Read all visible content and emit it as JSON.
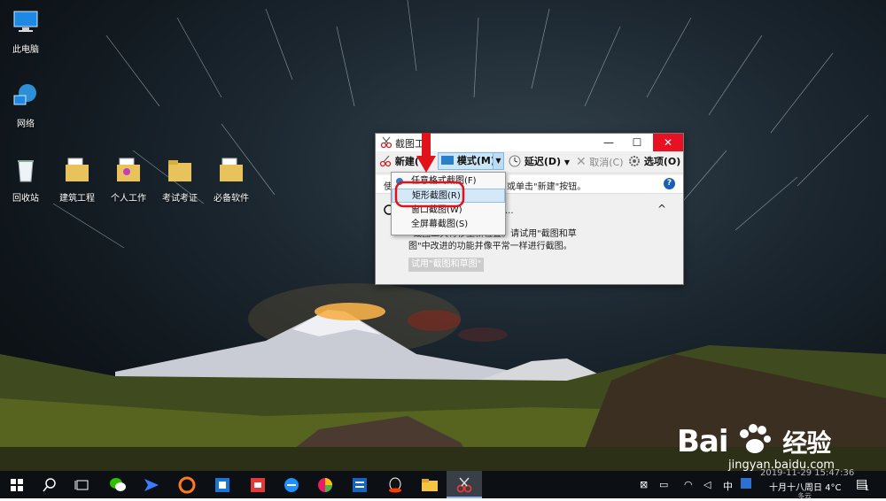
{
  "desktop_icons": [
    {
      "label": "此电脑",
      "icon": "computer-icon"
    },
    {
      "label": "网络",
      "icon": "network-icon"
    },
    {
      "label": "回收站",
      "icon": "recycle-bin-icon"
    },
    {
      "label": "建筑工程",
      "icon": "folder-icon"
    },
    {
      "label": "个人工作",
      "icon": "folder-icon"
    },
    {
      "label": "考试考证",
      "icon": "folder-icon"
    },
    {
      "label": "必备软件",
      "icon": "folder-icon"
    }
  ],
  "snipping_tool": {
    "title": "截图工",
    "window_controls": {
      "minimize": "—",
      "maximize": "☐",
      "close": "✕"
    },
    "toolbar": {
      "new_label": "新建(",
      "mode_label": "模式(M)",
      "delay_label": "延迟(D)",
      "cancel_label": "取消(C)",
      "options_label": "选项(O)"
    },
    "info_prefix": "使",
    "info_text": "或单击\"新建\"按钮。",
    "notice_tail": "...",
    "notice_line1": "“截图工具将移至新位置。请试用\"截图和草",
    "notice_line2": "图\"中改进的功能并像平常一样进行截图。",
    "try_button": "试用\"截图和草图\"",
    "collapse_glyph": "^",
    "help_glyph": "?"
  },
  "mode_menu": {
    "items": [
      {
        "label": "任意格式截图(F)",
        "selected": false
      },
      {
        "label": "矩形截图(R)",
        "selected": true
      },
      {
        "label": "窗口截图(W)",
        "selected": false
      },
      {
        "label": "全屏幕截图(S)",
        "selected": false
      }
    ]
  },
  "taskbar": {
    "tray": {
      "ime": "中",
      "datetime_partial": "2019-11-29 15:47:36",
      "date_lunar": "十月十八周日 4°C",
      "weather_partial": "多云",
      "notification_count": "1"
    }
  },
  "watermark": {
    "brand": "Bai",
    "brand2": "经验",
    "url": "jingyan.baidu.com"
  },
  "colors": {
    "accent": "#1a5fb4",
    "close": "#e81123",
    "annotation": "#e0121a",
    "highlight": "#d5e8f7"
  }
}
